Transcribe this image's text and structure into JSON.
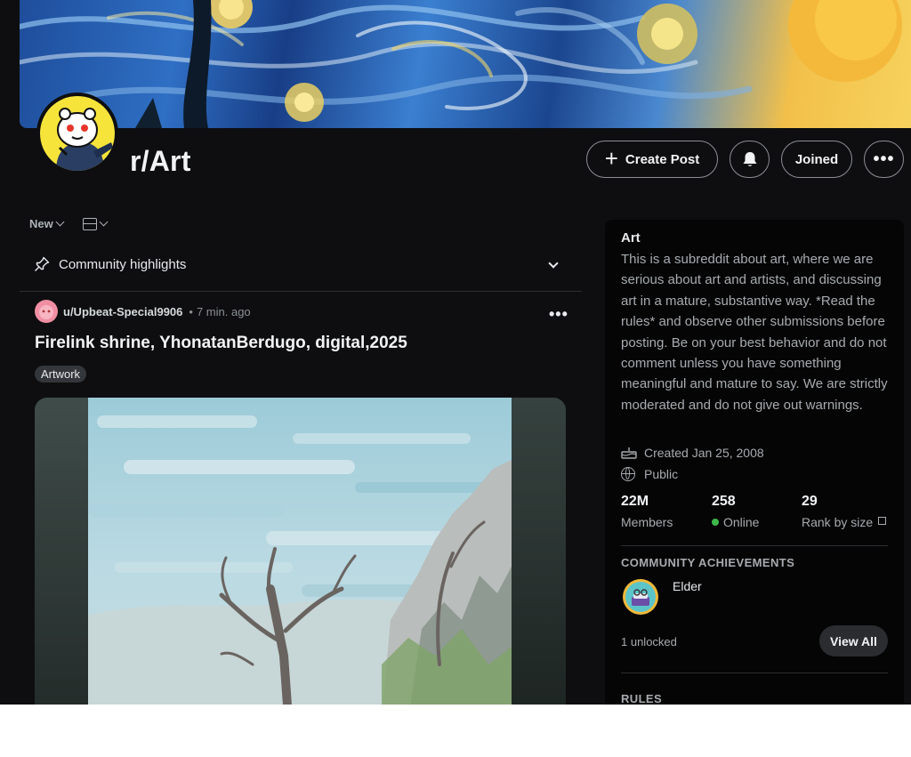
{
  "community": {
    "name": "r/Art",
    "create_post_label": "Create Post",
    "joined_label": "Joined",
    "more_label": "•••"
  },
  "feed": {
    "sort_label": "New",
    "highlights_label": "Community highlights"
  },
  "post": {
    "author": "u/Upbeat-Special9906",
    "separator": "•",
    "time": "7 min. ago",
    "title": "Firelink shrine, YhonatanBerdugo, digital,2025",
    "flair": "Artwork",
    "more_label": "•••"
  },
  "sidebar": {
    "title": "Art",
    "description": "This is a subreddit about art, where we are serious about art and artists, and discussing art in a mature, substantive way. *Read the rules* and observe other submissions before posting. Be on your best behavior and do not comment unless you have something meaningful and mature to say. We are strictly moderated and do not give out warnings.",
    "created": "Created Jan 25, 2008",
    "visibility": "Public",
    "stats": {
      "members_value": "22M",
      "members_label": "Members",
      "online_value": "258",
      "online_label": "Online",
      "rank_value": "29",
      "rank_label": "Rank by size"
    },
    "achievements_heading": "COMMUNITY ACHIEVEMENTS",
    "achievement_name": "Elder",
    "unlocked_text": "1 unlocked",
    "view_all_label": "View All",
    "rules_heading": "RULES"
  },
  "colors": {
    "background": "#0e0e10",
    "online": "#3fb94a",
    "avatar_yellow": "#f7e43b"
  }
}
